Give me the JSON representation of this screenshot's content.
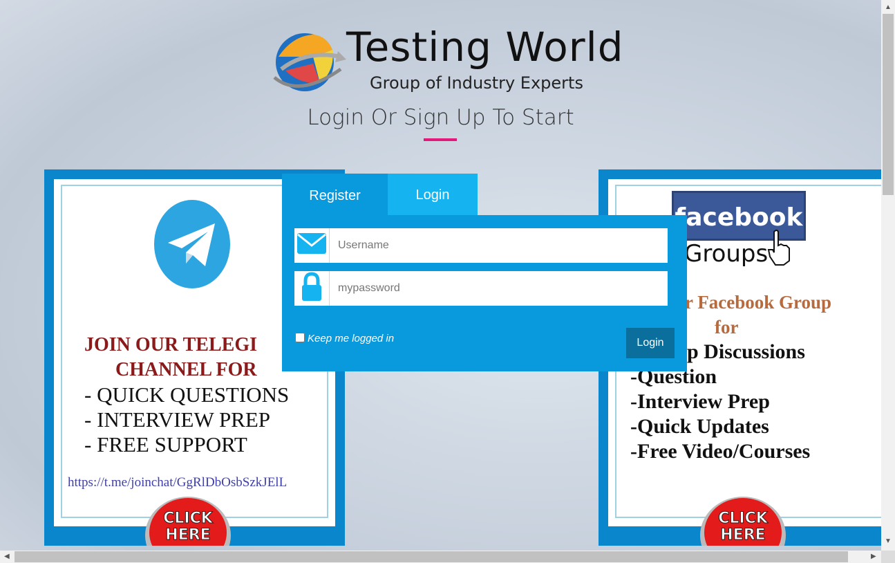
{
  "logo": {
    "title": "Testing World",
    "subtitle": "Group of Industry Experts"
  },
  "headline": "Login Or Sign Up To Start",
  "colors": {
    "accent": "#e2197b",
    "form_bg": "#0999dd",
    "active_tab": "#16b3f1",
    "login_button": "#0b6f9e",
    "promo_border": "#0a86cc"
  },
  "tabs": {
    "register": "Register",
    "login": "Login"
  },
  "form": {
    "username_placeholder": "Username",
    "password_placeholder": "mypassword",
    "keep_logged_in": "Keep me logged in",
    "login_button": "Login",
    "username_icon": "envelope-icon",
    "password_icon": "lock-icon"
  },
  "promo_left": {
    "heading_line1": "JOIN OUR TELEGI",
    "heading_line2": "CHANNEL  FOR",
    "items": [
      "- QUICK QUESTIONS",
      "- INTERVIEW PREP",
      "- FREE SUPPORT"
    ],
    "link": "https://t.me/joinchat/GgRlDbOsbSzkJElL",
    "cta": "CLICK HERE"
  },
  "promo_right": {
    "brand": "facebook",
    "groups": "Groups",
    "heading_line1": "ur Facebook Group",
    "heading_line2": "for",
    "items": [
      "p Discussions",
      "-Question",
      "-Interview Prep",
      "-Quick Updates",
      "-Free Video/Courses"
    ],
    "cta": "CLICK HERE"
  }
}
